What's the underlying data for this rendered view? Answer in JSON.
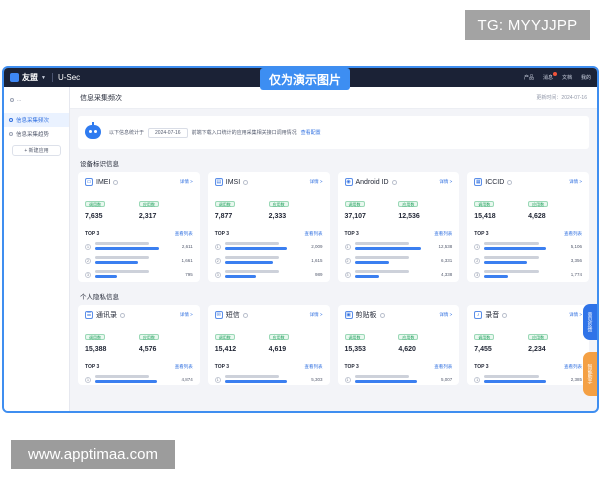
{
  "watermarks": {
    "tg": "TG: MYYJJPP",
    "url": "www.apptimaa.com",
    "banner": "仅为演示图片"
  },
  "topbar": {
    "brand": "友盟",
    "product": "U-Sec",
    "right_items": [
      "产品",
      "消息",
      "文档",
      "我的"
    ]
  },
  "sidebar": {
    "org": "...",
    "items": [
      {
        "label": "信息采集频次",
        "active": true
      },
      {
        "label": "信息采集趋势",
        "active": false
      }
    ],
    "new_app": "+ 新建应用"
  },
  "page": {
    "title": "信息采集频次",
    "update_time": "更新时间：2024-07-16"
  },
  "summary": {
    "prefix": "以下信息统计于",
    "date": "2024-07-16",
    "middle": "前端下载入口统计的应用采集相关接口调用情况",
    "link": "查看配置"
  },
  "sections": [
    {
      "title": "设备标识信息",
      "cards": [
        {
          "icon": "imei-icon",
          "title": "IMEI",
          "stat1_tag": "调用数",
          "stat1": "7,635",
          "stat2_tag": "应用数",
          "stat2": "2,317",
          "ranks": [
            {
              "value": "2,611",
              "bar": 0.82
            },
            {
              "value": "1,661",
              "bar": 0.55
            },
            {
              "value": "795",
              "bar": 0.28
            }
          ]
        },
        {
          "icon": "imsi-icon",
          "title": "IMSI",
          "stat1_tag": "调用数",
          "stat1": "7,877",
          "stat2_tag": "应用数",
          "stat2": "2,333",
          "ranks": [
            {
              "value": "2,009",
              "bar": 0.8
            },
            {
              "value": "1,615",
              "bar": 0.62
            },
            {
              "value": "989",
              "bar": 0.4
            }
          ]
        },
        {
          "icon": "android-icon",
          "title": "Android ID",
          "stat1_tag": "调用数",
          "stat1": "37,107",
          "stat2_tag": "应用数",
          "stat2": "12,536",
          "ranks": [
            {
              "value": "12,538",
              "bar": 0.85
            },
            {
              "value": "6,331",
              "bar": 0.45
            },
            {
              "value": "4,338",
              "bar": 0.32
            }
          ]
        },
        {
          "icon": "iccid-icon",
          "title": "ICCID",
          "stat1_tag": "调用数",
          "stat1": "15,418",
          "stat2_tag": "应用数",
          "stat2": "4,628",
          "ranks": [
            {
              "value": "5,106",
              "bar": 0.8
            },
            {
              "value": "3,356",
              "bar": 0.55
            },
            {
              "value": "1,774",
              "bar": 0.3
            }
          ]
        }
      ]
    },
    {
      "title": "个人隐私信息",
      "cards": [
        {
          "icon": "contacts-icon",
          "title": "通讯录",
          "stat1_tag": "调用数",
          "stat1": "15,388",
          "stat2_tag": "应用数",
          "stat2": "4,576",
          "ranks": [
            {
              "value": "4,874",
              "bar": 0.8
            }
          ]
        },
        {
          "icon": "sms-icon",
          "title": "短信",
          "stat1_tag": "调用数",
          "stat1": "15,412",
          "stat2_tag": "应用数",
          "stat2": "4,619",
          "ranks": [
            {
              "value": "5,303",
              "bar": 0.8
            }
          ]
        },
        {
          "icon": "clipboard-icon",
          "title": "剪贴板",
          "stat1_tag": "调用数",
          "stat1": "15,353",
          "stat2_tag": "应用数",
          "stat2": "4,620",
          "ranks": [
            {
              "value": "5,007",
              "bar": 0.8
            }
          ]
        },
        {
          "icon": "audio-icon",
          "title": "录音",
          "stat1_tag": "调用数",
          "stat1": "7,455",
          "stat2_tag": "应用数",
          "stat2": "2,234",
          "ranks": [
            {
              "value": "2,385",
              "bar": 0.8
            }
          ]
        }
      ]
    }
  ],
  "common": {
    "detail": "详情 >",
    "top3": "TOP 3",
    "more": "查看列表"
  },
  "floating": {
    "feedback": "意见反馈",
    "assistant": "智能助手"
  },
  "colors": {
    "accent": "#2f6fe0",
    "topbar": "#1b2236",
    "tag_green": "#1e9e5b",
    "bar_blue": "#3b7ff0"
  }
}
